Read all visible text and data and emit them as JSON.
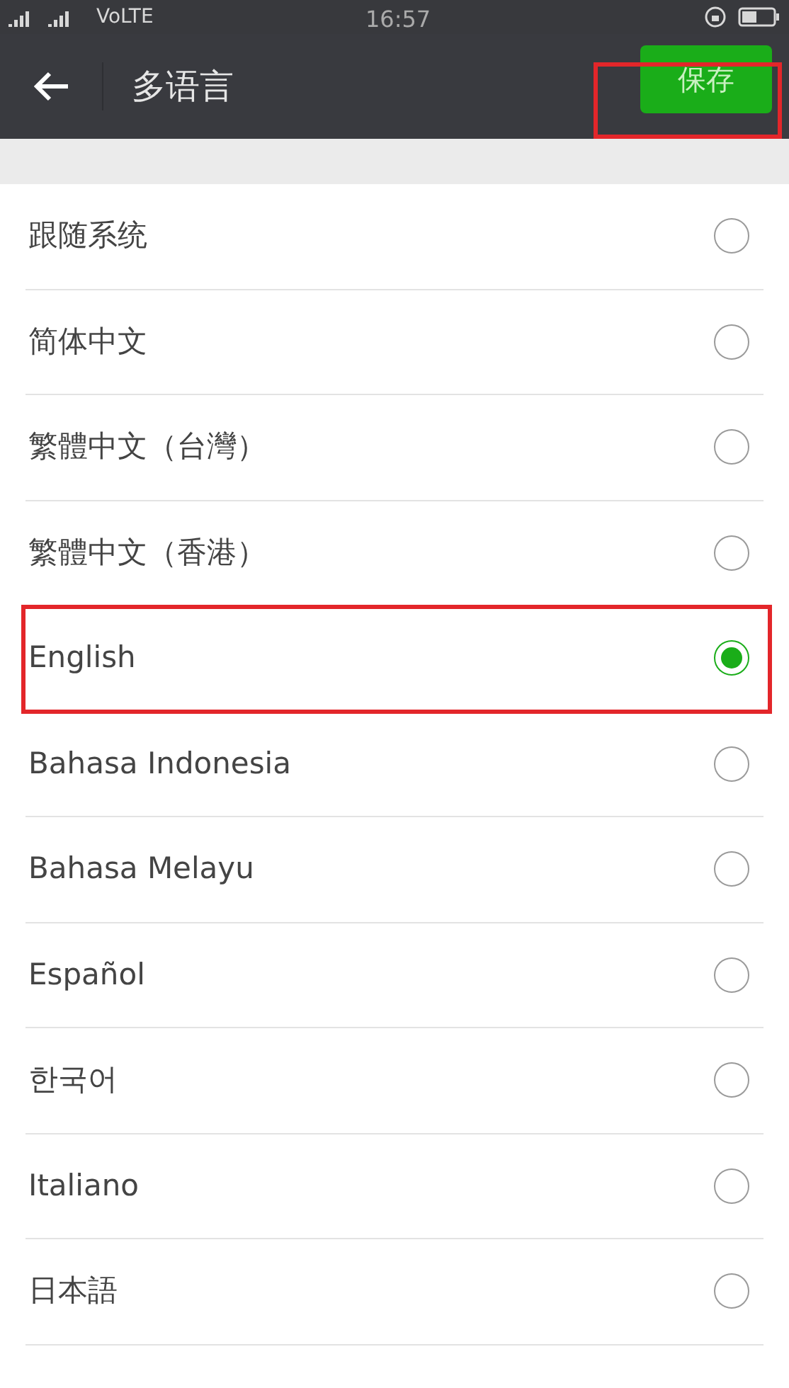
{
  "status_bar": {
    "network": "VoLTE",
    "time": "16:57"
  },
  "header": {
    "title": "多语言",
    "save_button": "保存",
    "save_highlighted": true
  },
  "languages": [
    {
      "label": "跟随系统",
      "selected": false,
      "highlighted": false
    },
    {
      "label": "简体中文",
      "selected": false,
      "highlighted": false
    },
    {
      "label": "繁體中文（台灣）",
      "selected": false,
      "highlighted": false
    },
    {
      "label": "繁體中文（香港）",
      "selected": false,
      "highlighted": false
    },
    {
      "label": "English",
      "selected": true,
      "highlighted": true
    },
    {
      "label": "Bahasa Indonesia",
      "selected": false,
      "highlighted": false
    },
    {
      "label": "Bahasa Melayu",
      "selected": false,
      "highlighted": false
    },
    {
      "label": "Español",
      "selected": false,
      "highlighted": false
    },
    {
      "label": "한국어",
      "selected": false,
      "highlighted": false
    },
    {
      "label": "Italiano",
      "selected": false,
      "highlighted": false
    },
    {
      "label": "日本語",
      "selected": false,
      "highlighted": false
    }
  ]
}
